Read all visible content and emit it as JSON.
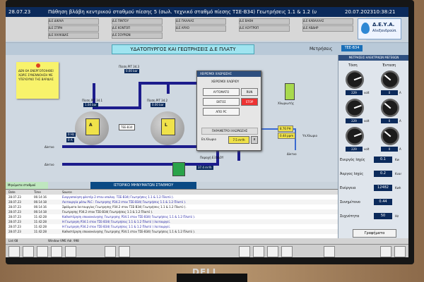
{
  "screen": {
    "date": "20.07.2023",
    "time": "10:38:21",
    "header_left": "28.07.23",
    "header_center": "Πάθηση βλάβη κεντρικού σταθμού πίεσης 5 (σωλ. τεχνικό σταθμό πίεσης ΤΣΕ-Β34) Γεωτρήσεις 1.1 & 1.2 (υπό χλ.)"
  },
  "header_tabs": [
    "Δ.Ε ΔΙΚΑΙΑ",
    "Δ.Ε ΠΙΝΤΟΥ",
    "Δ.Ε ΠΑΛΑΙΑΣ",
    "Δ.Ε ΒΑΘΗ",
    "Δ.Ε ΚΑΒΑΛΛΑΣ",
    "Δ.Ε ΣΤΙΡΗ",
    "Δ.Ε ΚΟΝΤΟΠ",
    "Δ.Ε ΑΡΧΟ",
    "Δ.Ε ΛΟΥΤΡΟΠ",
    "Δ.Ε ΑΒΔΗΡ",
    "Δ.Ε ΧΑΛΚΙΔΑΣ",
    "Δ.Ε ΣΟΥΡΙΩΝ"
  ],
  "logo": {
    "title": "Δ.Ε.Υ.Α.",
    "subtitle": "Αλεξανδρούπ."
  },
  "main": {
    "title": "ΥΔΑΤΟΠΥΡΓΟΣ ΚΑΙ ΓΕΩΤΡΗΣΕΙΣ Δ.Ε ΠΛΑΤΥ",
    "metrhseis_label": "Μετρήσεις",
    "tee_label": "TEE-B34",
    "date_badge": "28.07.23"
  },
  "note": {
    "text": "ΔΕΝ ΘΑ ΕΝΕΡΓΟΠΟΙΗΘΕΙ ΧΩΡΙΣ ΣΥΝΕΝΝΟΗΣΗ ΜΕ ΥΠΕΥΘΥΝΟ ΤΗΣ ΒΑΡΔΙΑΣ"
  },
  "process": {
    "tank1_label": "Πίεση ΡΙΤ 34.1",
    "tank1_value": "1.04 bar",
    "tank2_label": "Πίεση ΡΙΤ 34.2",
    "tank2_value": "0.00 bar",
    "tank3_label": "Πίεση ΡΙΤ 34.3",
    "tank3_value": "0.00 bar",
    "hz_value": "0 Hz",
    "a_value": "0 A",
    "pump_a": "A",
    "pump_l": "L",
    "tee_box": "TEE-B34",
    "diktyo1": "Δίκτυο",
    "diktyo2": "Δίκτυο",
    "dikt_out": "Δίκτυο",
    "pumpflow_label": "Παροχή ΕΞΟΔΟΥ",
    "pumpflow_value": "37.4 m³/h",
    "chlorination_label": "Χλωριωτής",
    "ph_value": "8.76 PH",
    "cl_value": "0.44 ppm",
    "cl_label": "Υπ.Χλωριο"
  },
  "popup": {
    "title": "ΧΕΙΡΙΣΜΟΙ ΧΛΩΡΙΩΣΗΣ",
    "subtitle": "ΧΕΙΡΙΣΜΟΙ ΧΛΩΡΙΟΥ",
    "btn_auto": "ΑΥΤΟΜΑΤΟ",
    "btn_off": "ΕΚΤΟΣ",
    "btn_pc": "ΑΠΟ PC",
    "state_run": "RUN",
    "state_stop": "STOP",
    "params": "ΠΑΡΑΜΕΤΡΟΙ ΧΛΩΡΙΩΣΗΣ",
    "chlorine_label": "Επ.Χλωριο",
    "chlorine_value": "7.5 m³/h",
    "close": "x"
  },
  "rpanel": {
    "header": "ΜΕΤΡΗΣΕΙΣ ΗΛΕΚΤΡΙΚΩΝ ΜΕΓΕΘΩΝ",
    "tasi_label": "Τάση",
    "revma_label": "Ένταση",
    "gauges": [
      {
        "label": "",
        "value": "229",
        "unit": "volt"
      },
      {
        "label": "",
        "value": "0",
        "unit": "A"
      },
      {
        "label": "",
        "value": "229",
        "unit": "volt"
      },
      {
        "label": "",
        "value": "0",
        "unit": "A"
      },
      {
        "label": "",
        "value": "229",
        "unit": "volt"
      },
      {
        "label": "",
        "value": "0",
        "unit": "A"
      }
    ],
    "measurements": [
      {
        "label": "Ενεργός Ισχύς",
        "value": "0.1",
        "unit": "Kw"
      },
      {
        "label": "Άεργος Ισχύς",
        "value": "0.2",
        "unit": "Kvar"
      },
      {
        "label": "Ενέργεια",
        "value": "12482",
        "unit": "Kwh"
      },
      {
        "label": "Συνημίτονο",
        "value": "0.44",
        "unit": ""
      },
      {
        "label": "Συχνότητα",
        "value": "50",
        "unit": "Hz"
      }
    ],
    "graph_btn": "Γραφήματα"
  },
  "messages": {
    "header": "ΙΣΤΟΡΙΚΟ ΜΗΝΥΜΑΤΩΝ ΣΤΑΘΜΟΥ",
    "tab": "Μηνύματα σταθμού",
    "columns": [
      "Date",
      "Time",
      "Source"
    ],
    "rows": [
      {
        "date": "28.07.23",
        "time": "06:14:16",
        "source": "Ενεργοποίηση φλοτέρ 2 στον υπολογ. ΤΣΕ-Β34( Γεωτρήσεις 1.1 & 1.2 Πλατύ )."
      },
      {
        "date": "28.07.23",
        "time": "06:14:18",
        "source": "Λειτουργία μέσω PLC : Γεωτρησης Ρ34.2 στον ΤΣΕ-Β34( Γεωτρήσεις 1.1 & 1.2 Πλατύ )."
      },
      {
        "date": "28.07.23",
        "time": "06:14:16",
        "source": "Σφάλματα λειτουργίας Γεωτρησης Ρ34.2 στον ΤΣΕ-Β34( Γεωτρήσεις 1.1 & 1.2 Πλατύ )."
      },
      {
        "date": "28.07.23",
        "time": "06:14:18",
        "source": "Γεωτρησης Ρ34.2 στον ΤΣΕ-Β34( Γεωτρήσεις 1.1 & 1.2 Πλατύ )."
      },
      {
        "date": "28.07.23",
        "time": "11:42:28",
        "source": "Καθυστέρηση επανεκκίνησης Γεωτρησης Ρ34.1 στον ΤΣΕ-Β34( Γεωτρήσεις 1.1 & 1.2 Πλατύ )."
      },
      {
        "date": "28.07.23",
        "time": "11:42:28",
        "source": "Η Γεωτρηση Ρ34.1 στον ΤΣΕ-Β34( Γεωτρήσεις 1.1 & 1.2 Πλατύ ) λειτουργεί."
      },
      {
        "date": "28.07.23",
        "time": "11:42:28",
        "source": "Η Γεωτρηση Ρ34.2 στον ΤΣΕ-Β34( Γεωτρήσεις 1.1 & 1.2 Πλατύ ) λειτουργεί."
      },
      {
        "date": "28.07.23",
        "time": "11:42:28",
        "source": "Καθυστέρηση επανεκκίνησης Γεωτρησης Ρ34.1 στον ΤΣΕ-Β34( Γεωτρήσεις 1.1 & 1.2 Πλατύ )."
      }
    ]
  },
  "statusbar": {
    "left": "List 68",
    "mid": "Window VME Adr. 998"
  },
  "brand": "DELL"
}
